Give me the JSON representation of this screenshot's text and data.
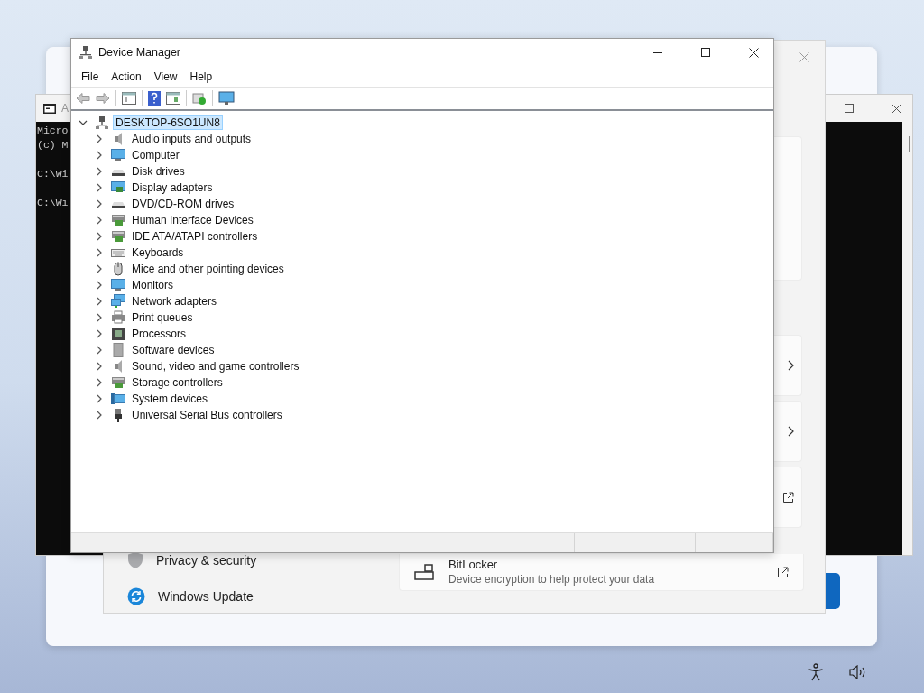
{
  "command_prompt": {
    "title": "A",
    "blocks": [
      [
        "Micro",
        "(c) M"
      ],
      [
        "C:\\Wi"
      ],
      [
        "C:\\Wi"
      ]
    ]
  },
  "settings": {
    "nav": [
      {
        "label": "Privacy & security",
        "kind": "shield"
      },
      {
        "label": "Windows Update",
        "kind": "update"
      }
    ],
    "cards": [
      {
        "kind": "blank"
      },
      {
        "kind": "chevron"
      },
      {
        "kind": "chevron"
      },
      {
        "kind": "external"
      }
    ],
    "bitlocker": {
      "title": "BitLocker",
      "description": "Device encryption to help protect your data"
    }
  },
  "device_manager": {
    "title": "Device Manager",
    "menu": [
      "File",
      "Action",
      "View",
      "Help"
    ],
    "tree": {
      "label": "DESKTOP-6SO1UN8",
      "expanded": true,
      "selected": true,
      "children": [
        {
          "label": "Audio inputs and outputs",
          "expanded": false,
          "selected": false
        },
        {
          "label": "Computer",
          "expanded": false,
          "selected": false
        },
        {
          "label": "Disk drives",
          "expanded": false,
          "selected": false
        },
        {
          "label": "Display adapters",
          "expanded": false,
          "selected": false
        },
        {
          "label": "DVD/CD-ROM drives",
          "expanded": false,
          "selected": false
        },
        {
          "label": "Human Interface Devices",
          "expanded": false,
          "selected": false
        },
        {
          "label": "IDE ATA/ATAPI controllers",
          "expanded": false,
          "selected": false
        },
        {
          "label": "Keyboards",
          "expanded": false,
          "selected": false
        },
        {
          "label": "Mice and other pointing devices",
          "expanded": false,
          "selected": false
        },
        {
          "label": "Monitors",
          "expanded": false,
          "selected": false
        },
        {
          "label": "Network adapters",
          "expanded": false,
          "selected": false
        },
        {
          "label": "Print queues",
          "expanded": false,
          "selected": false
        },
        {
          "label": "Processors",
          "expanded": false,
          "selected": false
        },
        {
          "label": "Software devices",
          "expanded": false,
          "selected": false
        },
        {
          "label": "Sound, video and game controllers",
          "expanded": false,
          "selected": false
        },
        {
          "label": "Storage controllers",
          "expanded": false,
          "selected": false
        },
        {
          "label": "System devices",
          "expanded": false,
          "selected": false
        },
        {
          "label": "Universal Serial Bus controllers",
          "expanded": false,
          "selected": false
        }
      ]
    }
  }
}
